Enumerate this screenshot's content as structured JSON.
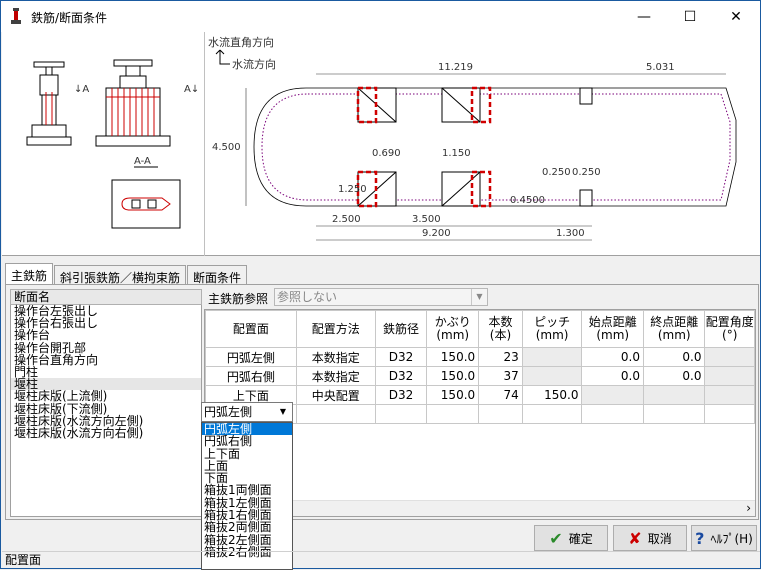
{
  "window": {
    "title": "鉄筋/断面条件",
    "minimize": "—",
    "maximize": "☐",
    "close": "✕"
  },
  "figure": {
    "section_label": "A-A",
    "arrow_label": "A",
    "flow_perpendicular": "水流直角方向",
    "flow_direction": "水流方向",
    "dims": {
      "total_top": "11.219",
      "right_top": "5.031",
      "height": "4.500",
      "d0690": "0.690",
      "d1150": "1.150",
      "d0250a": "0.250",
      "d0250b": "0.250",
      "d1250": "1.250",
      "d0450": "0.4500",
      "d2500": "2.500",
      "d3500": "3.500",
      "d9200": "9.200",
      "d1300": "1.300"
    }
  },
  "tabs": [
    "主鉄筋",
    "斜引張鉄筋／横拘束筋",
    "断面条件"
  ],
  "list": {
    "header": "断面名",
    "items": [
      "操作台左張出し",
      "操作台右張出し",
      "操作台",
      "操作台開孔部",
      "操作台直角方向",
      "門柱",
      "堰柱",
      "堰柱床版(上流側)",
      "堰柱床版(下流側)",
      "堰柱床版(水流方向左側)",
      "堰柱床版(水流方向右側)"
    ],
    "selected_index": 6
  },
  "reference": {
    "label": "主鉄筋参照",
    "value": "参照しない"
  },
  "grid": {
    "headers": [
      "配置面",
      "配置方法",
      "鉄筋径",
      "かぶり\n(mm)",
      "本数\n(本)",
      "ピッチ\n(mm)",
      "始点距離\n(mm)",
      "終点距離\n(mm)",
      "配置角度\n(°)"
    ],
    "rows": [
      [
        "円弧左側",
        "本数指定",
        "D32",
        "150.0",
        "23",
        "",
        "0.0",
        "0.0",
        ""
      ],
      [
        "円弧右側",
        "本数指定",
        "D32",
        "150.0",
        "37",
        "",
        "0.0",
        "0.0",
        ""
      ],
      [
        "上下面",
        "中央配置",
        "D32",
        "150.0",
        "74",
        "150.0",
        "",
        "",
        ""
      ]
    ],
    "editing_value": "円弧左側"
  },
  "dropdown": {
    "options": [
      "円弧左側",
      "円弧右側",
      "上下面",
      "上面",
      "下面",
      "箱抜1両側面",
      "箱抜1左側面",
      "箱抜1右側面",
      "箱抜2両側面",
      "箱抜2左側面",
      "箱抜2右側面"
    ],
    "highlighted_index": 0
  },
  "buttons": {
    "ok": "確定",
    "cancel": "取消",
    "help": "ﾍﾙﾌﾟ(H)"
  },
  "status": "配置面",
  "colors": {
    "accent": "#0078d7",
    "rebar": "#cc0000",
    "dots": "#7a007a"
  }
}
